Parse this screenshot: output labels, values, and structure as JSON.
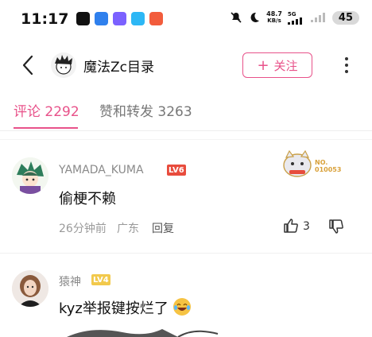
{
  "status_bar": {
    "time": "11:17",
    "speed_value": "48.7",
    "speed_unit": "KB/s",
    "network": "5G",
    "battery": "45"
  },
  "header": {
    "title": "魔法Zc目录",
    "follow_label": "关注",
    "follow_plus": "+"
  },
  "tabs": [
    {
      "label": "评论 2292",
      "active": true
    },
    {
      "label": "赞和转发 3263",
      "active": false
    }
  ],
  "comments": [
    {
      "username": "YAMADA_KUMA",
      "level": "LV6",
      "text": "偷梗不赖",
      "time": "26分钟前",
      "location": "广东",
      "reply_label": "回复",
      "likes": "3",
      "badge_label": "NO.",
      "badge_number": "010053"
    },
    {
      "username": "猿神",
      "level": "LV4",
      "text": "kyz举报键按烂了"
    }
  ],
  "colors": {
    "accent": "#e8528a",
    "lv6": "#e84c3d",
    "lv4": "#f2c94c"
  }
}
